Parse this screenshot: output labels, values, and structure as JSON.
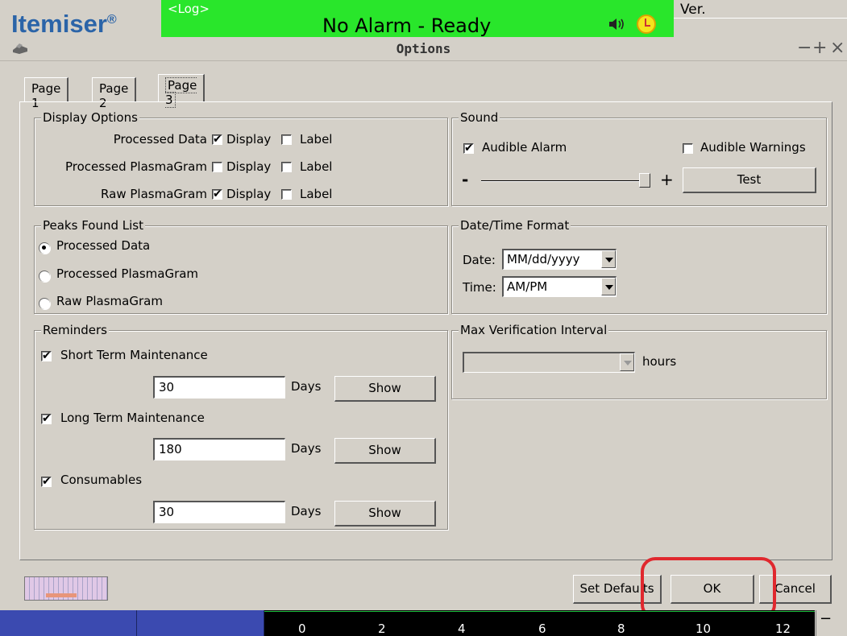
{
  "app": {
    "brand": "Itemiser",
    "brand_mark": "®",
    "log_tag": "<Log>",
    "status": "No Alarm - Ready",
    "version_label": "Ver.",
    "status_color": "#29e62b",
    "brand_color": "#2b64a8"
  },
  "dialog": {
    "title": "Options",
    "window_buttons": {
      "minimize": "−",
      "maximize": "+",
      "close": "×"
    }
  },
  "tabs": [
    {
      "label": "Page 1",
      "active": false
    },
    {
      "label": "Page 2",
      "active": false
    },
    {
      "label": "Page 3",
      "active": true
    }
  ],
  "display_options": {
    "title": "Display Options",
    "display_label": "Display",
    "label_label": "Label",
    "rows": [
      {
        "name": "Processed Data",
        "display": true,
        "label": false
      },
      {
        "name": "Processed PlasmaGram",
        "display": false,
        "label": false
      },
      {
        "name": "Raw PlasmaGram",
        "display": true,
        "label": false
      }
    ]
  },
  "peaks_found": {
    "title": "Peaks Found List",
    "options": [
      "Processed Data",
      "Processed PlasmaGram",
      "Raw PlasmaGram"
    ],
    "selected": "Processed Data"
  },
  "reminders": {
    "title": "Reminders",
    "days_label": "Days",
    "show_label": "Show",
    "items": [
      {
        "name": "Short Term Maintenance",
        "checked": true,
        "days": "30"
      },
      {
        "name": "Long Term Maintenance",
        "checked": true,
        "days": "180"
      },
      {
        "name": "Consumables",
        "checked": true,
        "days": "30"
      }
    ]
  },
  "sound": {
    "title": "Sound",
    "audible_alarm": {
      "label": "Audible Alarm",
      "checked": true
    },
    "audible_warnings": {
      "label": "Audible Warnings",
      "checked": false
    },
    "minus": "-",
    "plus": "+",
    "volume": 1.0,
    "test_label": "Test"
  },
  "datetime": {
    "title": "Date/Time Format",
    "date_label": "Date:",
    "date_value": "MM/dd/yyyy",
    "time_label": "Time:",
    "time_value": "AM/PM"
  },
  "verification": {
    "title": "Max Verification Interval",
    "value": "",
    "unit": "hours"
  },
  "footer": {
    "set_defaults": "Set Defaults",
    "ok": "OK",
    "cancel": "Cancel"
  },
  "graph": {
    "ticks": [
      "0",
      "2",
      "4",
      "6",
      "8",
      "10",
      "12"
    ],
    "minus": "−"
  }
}
